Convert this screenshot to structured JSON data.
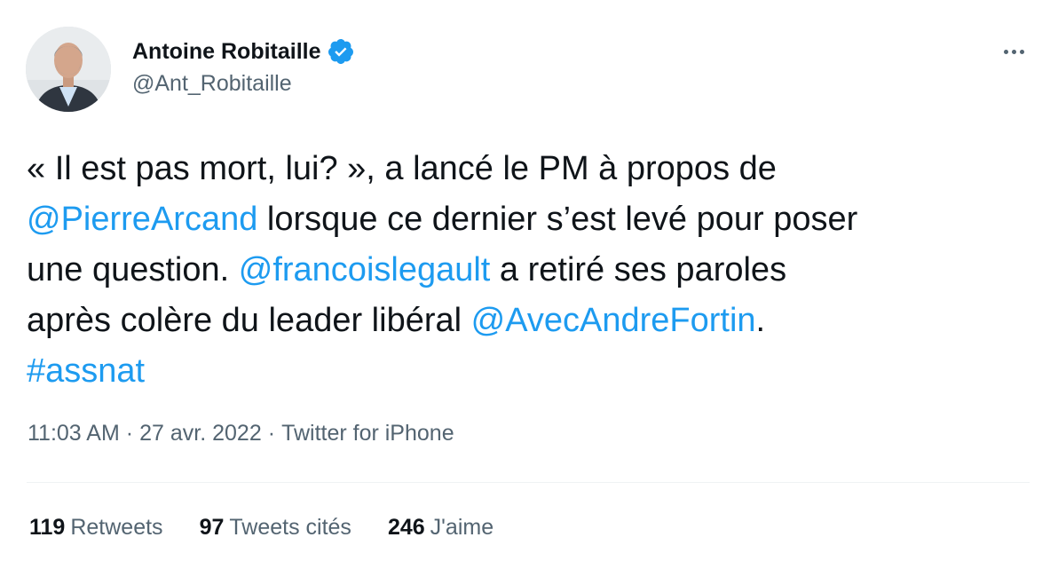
{
  "author": {
    "display_name": "Antoine Robitaille",
    "handle": "@Ant_Robitaille"
  },
  "tweet": {
    "lines": [
      [
        {
          "t": "« Il est pas mort, lui? », a lancé le PM à propos de",
          "link": false
        }
      ],
      [
        {
          "t": "@PierreArcand",
          "link": true
        },
        {
          "t": " lorsque ce dernier s’est levé pour poser",
          "link": false
        }
      ],
      [
        {
          "t": "une question. ",
          "link": false
        },
        {
          "t": "@francoislegault",
          "link": true
        },
        {
          "t": " a retiré ses paroles",
          "link": false
        }
      ],
      [
        {
          "t": "après colère du leader libéral ",
          "link": false
        },
        {
          "t": "@AvecAndreFortin",
          "link": true
        },
        {
          "t": ".",
          "link": false
        }
      ],
      [
        {
          "t": "#assnat",
          "link": true
        }
      ]
    ]
  },
  "meta": {
    "time": "11:03 AM",
    "separator": "·",
    "date": "27 avr. 2022",
    "source": "Twitter for iPhone"
  },
  "stats": {
    "retweets": {
      "count": "119",
      "label": "Retweets"
    },
    "quotes": {
      "count": "97",
      "label": "Tweets cités"
    },
    "likes": {
      "count": "246",
      "label": "J'aime"
    }
  },
  "icons": {
    "verified": "verified-badge-icon",
    "more": "more-options-icon"
  },
  "colors": {
    "link": "#1d9bf0",
    "text": "#0f1419",
    "secondary": "#536471",
    "divider": "#eff3f4"
  }
}
